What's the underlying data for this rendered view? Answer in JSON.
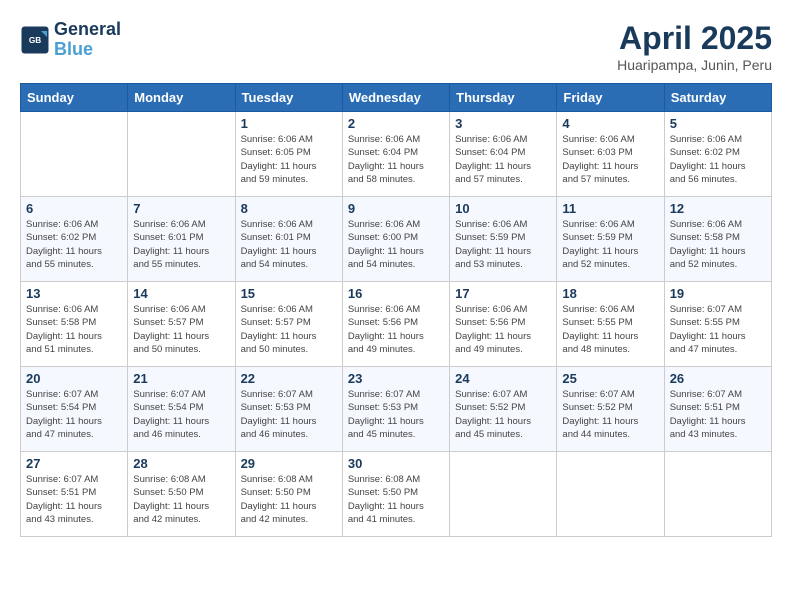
{
  "header": {
    "logo_line1": "General",
    "logo_line2": "Blue",
    "month_year": "April 2025",
    "location": "Huaripampa, Junin, Peru"
  },
  "weekdays": [
    "Sunday",
    "Monday",
    "Tuesday",
    "Wednesday",
    "Thursday",
    "Friday",
    "Saturday"
  ],
  "weeks": [
    [
      {
        "day": "",
        "info": ""
      },
      {
        "day": "",
        "info": ""
      },
      {
        "day": "1",
        "info": "Sunrise: 6:06 AM\nSunset: 6:05 PM\nDaylight: 11 hours\nand 59 minutes."
      },
      {
        "day": "2",
        "info": "Sunrise: 6:06 AM\nSunset: 6:04 PM\nDaylight: 11 hours\nand 58 minutes."
      },
      {
        "day": "3",
        "info": "Sunrise: 6:06 AM\nSunset: 6:04 PM\nDaylight: 11 hours\nand 57 minutes."
      },
      {
        "day": "4",
        "info": "Sunrise: 6:06 AM\nSunset: 6:03 PM\nDaylight: 11 hours\nand 57 minutes."
      },
      {
        "day": "5",
        "info": "Sunrise: 6:06 AM\nSunset: 6:02 PM\nDaylight: 11 hours\nand 56 minutes."
      }
    ],
    [
      {
        "day": "6",
        "info": "Sunrise: 6:06 AM\nSunset: 6:02 PM\nDaylight: 11 hours\nand 55 minutes."
      },
      {
        "day": "7",
        "info": "Sunrise: 6:06 AM\nSunset: 6:01 PM\nDaylight: 11 hours\nand 55 minutes."
      },
      {
        "day": "8",
        "info": "Sunrise: 6:06 AM\nSunset: 6:01 PM\nDaylight: 11 hours\nand 54 minutes."
      },
      {
        "day": "9",
        "info": "Sunrise: 6:06 AM\nSunset: 6:00 PM\nDaylight: 11 hours\nand 54 minutes."
      },
      {
        "day": "10",
        "info": "Sunrise: 6:06 AM\nSunset: 5:59 PM\nDaylight: 11 hours\nand 53 minutes."
      },
      {
        "day": "11",
        "info": "Sunrise: 6:06 AM\nSunset: 5:59 PM\nDaylight: 11 hours\nand 52 minutes."
      },
      {
        "day": "12",
        "info": "Sunrise: 6:06 AM\nSunset: 5:58 PM\nDaylight: 11 hours\nand 52 minutes."
      }
    ],
    [
      {
        "day": "13",
        "info": "Sunrise: 6:06 AM\nSunset: 5:58 PM\nDaylight: 11 hours\nand 51 minutes."
      },
      {
        "day": "14",
        "info": "Sunrise: 6:06 AM\nSunset: 5:57 PM\nDaylight: 11 hours\nand 50 minutes."
      },
      {
        "day": "15",
        "info": "Sunrise: 6:06 AM\nSunset: 5:57 PM\nDaylight: 11 hours\nand 50 minutes."
      },
      {
        "day": "16",
        "info": "Sunrise: 6:06 AM\nSunset: 5:56 PM\nDaylight: 11 hours\nand 49 minutes."
      },
      {
        "day": "17",
        "info": "Sunrise: 6:06 AM\nSunset: 5:56 PM\nDaylight: 11 hours\nand 49 minutes."
      },
      {
        "day": "18",
        "info": "Sunrise: 6:06 AM\nSunset: 5:55 PM\nDaylight: 11 hours\nand 48 minutes."
      },
      {
        "day": "19",
        "info": "Sunrise: 6:07 AM\nSunset: 5:55 PM\nDaylight: 11 hours\nand 47 minutes."
      }
    ],
    [
      {
        "day": "20",
        "info": "Sunrise: 6:07 AM\nSunset: 5:54 PM\nDaylight: 11 hours\nand 47 minutes."
      },
      {
        "day": "21",
        "info": "Sunrise: 6:07 AM\nSunset: 5:54 PM\nDaylight: 11 hours\nand 46 minutes."
      },
      {
        "day": "22",
        "info": "Sunrise: 6:07 AM\nSunset: 5:53 PM\nDaylight: 11 hours\nand 46 minutes."
      },
      {
        "day": "23",
        "info": "Sunrise: 6:07 AM\nSunset: 5:53 PM\nDaylight: 11 hours\nand 45 minutes."
      },
      {
        "day": "24",
        "info": "Sunrise: 6:07 AM\nSunset: 5:52 PM\nDaylight: 11 hours\nand 45 minutes."
      },
      {
        "day": "25",
        "info": "Sunrise: 6:07 AM\nSunset: 5:52 PM\nDaylight: 11 hours\nand 44 minutes."
      },
      {
        "day": "26",
        "info": "Sunrise: 6:07 AM\nSunset: 5:51 PM\nDaylight: 11 hours\nand 43 minutes."
      }
    ],
    [
      {
        "day": "27",
        "info": "Sunrise: 6:07 AM\nSunset: 5:51 PM\nDaylight: 11 hours\nand 43 minutes."
      },
      {
        "day": "28",
        "info": "Sunrise: 6:08 AM\nSunset: 5:50 PM\nDaylight: 11 hours\nand 42 minutes."
      },
      {
        "day": "29",
        "info": "Sunrise: 6:08 AM\nSunset: 5:50 PM\nDaylight: 11 hours\nand 42 minutes."
      },
      {
        "day": "30",
        "info": "Sunrise: 6:08 AM\nSunset: 5:50 PM\nDaylight: 11 hours\nand 41 minutes."
      },
      {
        "day": "",
        "info": ""
      },
      {
        "day": "",
        "info": ""
      },
      {
        "day": "",
        "info": ""
      }
    ]
  ]
}
